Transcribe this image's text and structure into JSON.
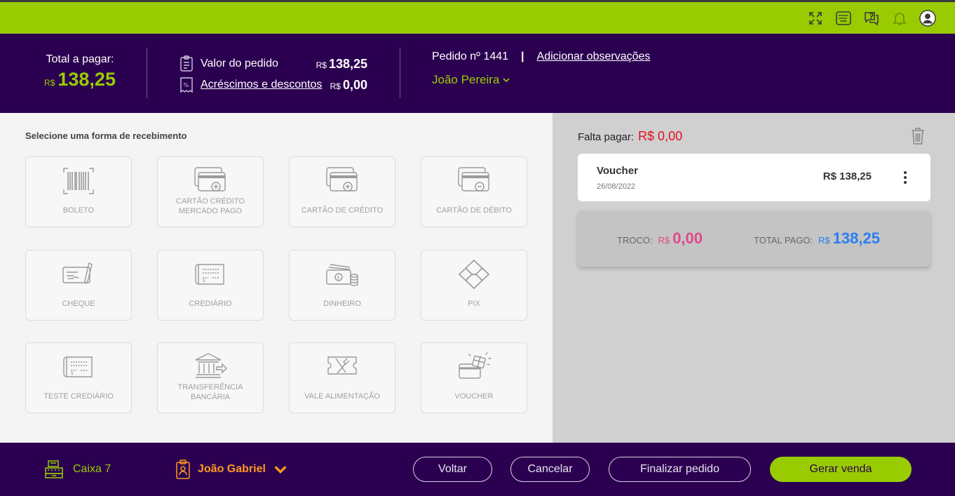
{
  "colors": {
    "accent_green": "#98cc00",
    "header_purple": "#2b0051",
    "danger_red": "#e0101c",
    "troco_pink": "#e04a8a",
    "total_blue": "#2a7df0",
    "operator_orange": "#ff9a1f"
  },
  "topbar": {
    "icons": [
      "fullscreen-icon",
      "keyboard-icon",
      "help-icon",
      "bell-icon",
      "user-avatar-icon"
    ]
  },
  "header": {
    "total_label": "Total a pagar:",
    "total_currency": "R$",
    "total_value": "138,25",
    "valor_pedido_label": "Valor do pedido",
    "valor_pedido_currency": "R$",
    "valor_pedido_value": "138,25",
    "acrescimos_label": "Acréscimos e descontos",
    "acrescimos_currency": "R$",
    "acrescimos_value": "0,00",
    "pedido_label": "Pedido nº 1441",
    "separator": "|",
    "observacoes_link": "Adicionar observações",
    "cliente": "João Pereira"
  },
  "payment_methods": {
    "title": "Selecione uma forma de recebimento",
    "items": [
      {
        "label": "BOLETO",
        "icon": "barcode-icon"
      },
      {
        "label": "CARTÃO CRÉDITO MERCADO PAGO",
        "icon": "credit-card-plus-icon"
      },
      {
        "label": "CARTÃO DE CRÉDITO",
        "icon": "credit-card-plus-icon"
      },
      {
        "label": "CARTÃO DE DÉBITO",
        "icon": "debit-card-minus-icon"
      },
      {
        "label": "CHEQUE",
        "icon": "cheque-icon"
      },
      {
        "label": "CREDIÁRIO",
        "icon": "crediario-icon"
      },
      {
        "label": "DINHEIRO",
        "icon": "cash-icon"
      },
      {
        "label": "PIX",
        "icon": "pix-icon"
      },
      {
        "label": "TESTE CREDIÁRIO",
        "icon": "crediario-icon"
      },
      {
        "label": "TRANSFERÊNCIA BANCÁRIA",
        "icon": "bank-transfer-icon"
      },
      {
        "label": "VALE ALIMENTAÇÃO",
        "icon": "food-voucher-icon"
      },
      {
        "label": "VOUCHER",
        "icon": "voucher-gift-icon"
      }
    ]
  },
  "payments_panel": {
    "falta_label": "Falta pagar:",
    "falta_value": "R$ 0,00",
    "entries": [
      {
        "name": "Voucher",
        "date": "26/08/2022",
        "amount": "R$ 138,25"
      }
    ],
    "troco_label": "TROCO:",
    "troco_currency": "R$",
    "troco_value": "0,00",
    "total_pago_label": "TOTAL PAGO:",
    "total_pago_currency": "R$",
    "total_pago_value": "138,25"
  },
  "footer": {
    "caixa": "Caixa 7",
    "operador": "João Gabriel",
    "voltar": "Voltar",
    "cancelar": "Cancelar",
    "finalizar": "Finalizar pedido",
    "gerar_venda": "Gerar venda"
  }
}
